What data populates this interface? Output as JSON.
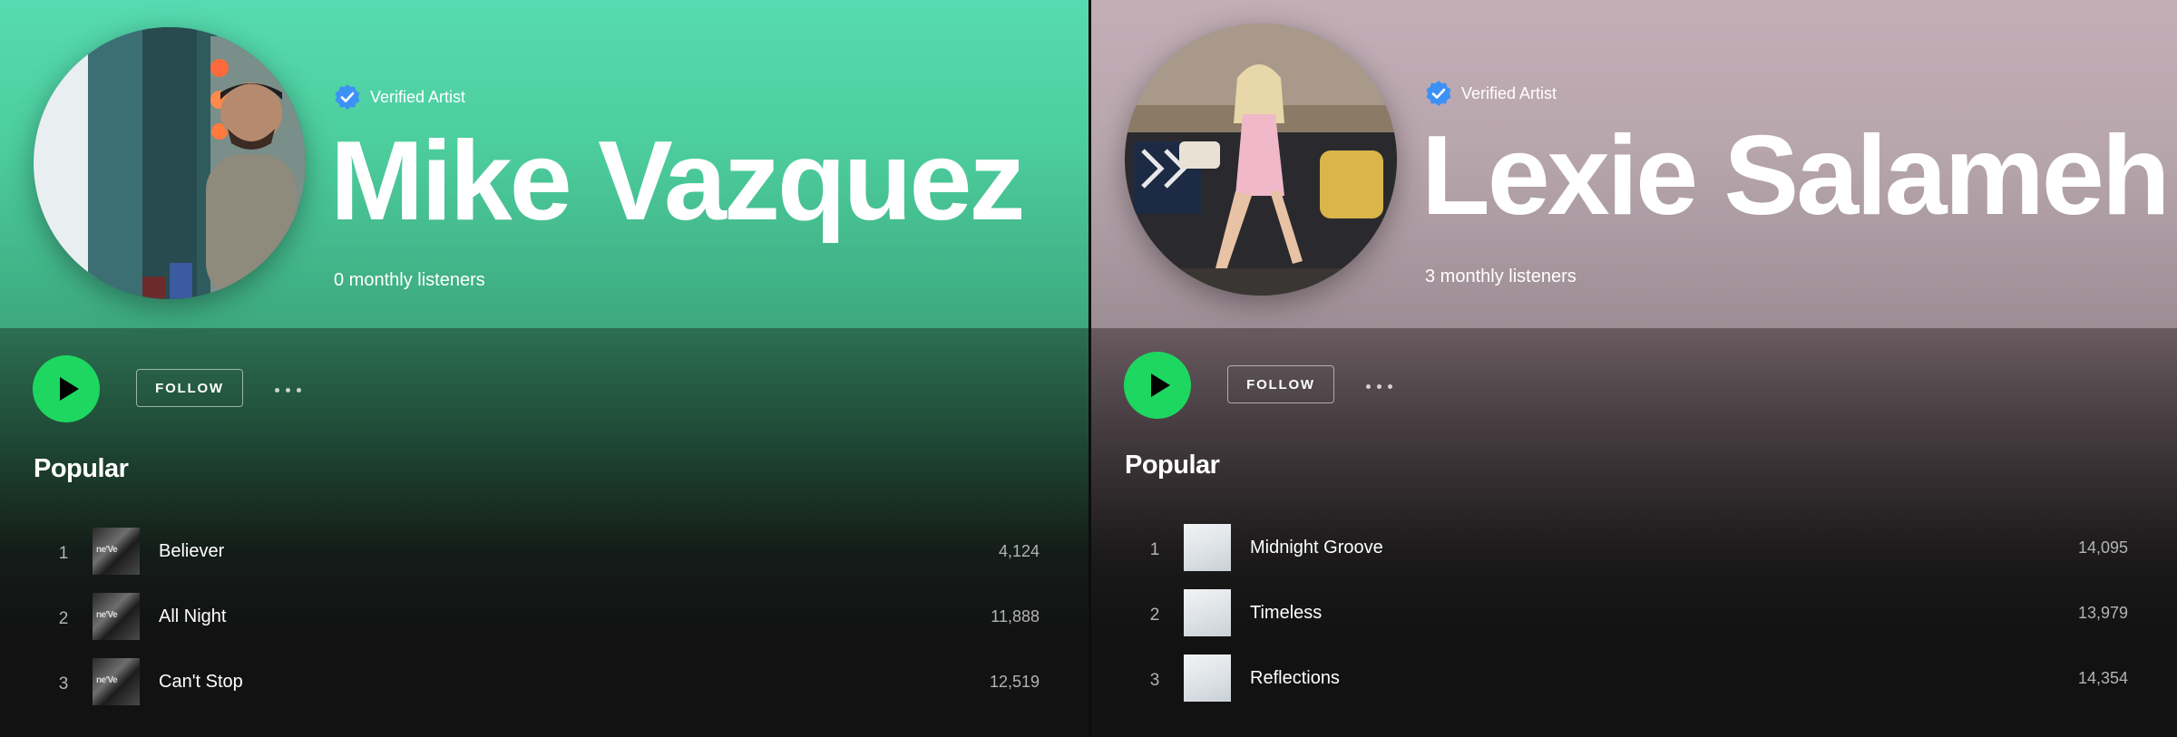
{
  "left": {
    "verified_label": "Verified Artist",
    "artist_name": "Mike Vazquez",
    "monthly_listeners": "0 monthly listeners",
    "follow_label": "FOLLOW",
    "popular_heading": "Popular",
    "tracks": [
      {
        "number": "1",
        "title": "Believer",
        "plays": "4,124"
      },
      {
        "number": "2",
        "title": "All Night",
        "plays": "11,888"
      },
      {
        "number": "3",
        "title": "Can't Stop",
        "plays": "12,519"
      }
    ]
  },
  "right": {
    "verified_label": "Verified Artist",
    "artist_name": "Lexie Salameh",
    "monthly_listeners": "3 monthly listeners",
    "follow_label": "FOLLOW",
    "popular_heading": "Popular",
    "tracks": [
      {
        "number": "1",
        "title": "Midnight Groove",
        "plays": "14,095"
      },
      {
        "number": "2",
        "title": "Timeless",
        "plays": "13,979"
      },
      {
        "number": "3",
        "title": "Reflections",
        "plays": "14,354"
      }
    ]
  },
  "colors": {
    "play_green": "#1ed760",
    "verified_blue": "#3d91f4",
    "left_header": "#4ccd9e",
    "right_header": "#b8a6ad",
    "background": "#121212"
  },
  "icons": [
    "verified-badge-icon",
    "play-icon",
    "more-options-icon"
  ]
}
